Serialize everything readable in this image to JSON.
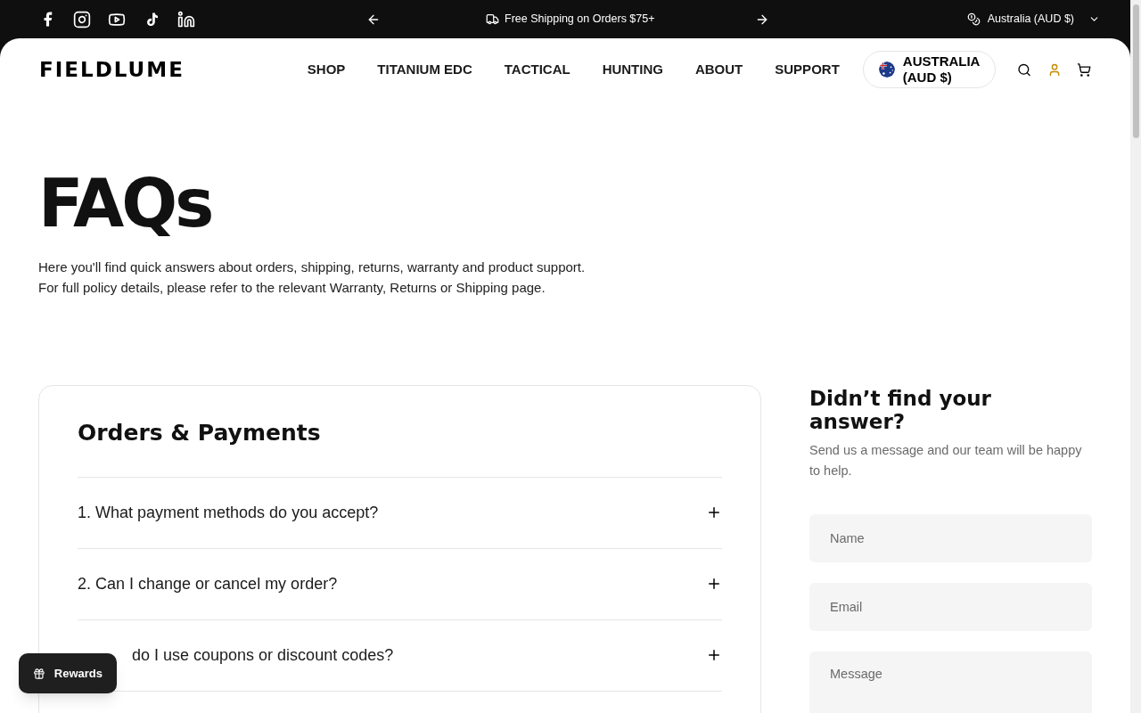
{
  "announcement_bar": {
    "message": "Free Shipping on Orders $75+",
    "currency": "Australia (AUD $)"
  },
  "header": {
    "logo": "FIELDLUME",
    "nav": [
      {
        "label": "SHOP"
      },
      {
        "label": "TITANIUM EDC"
      },
      {
        "label": "TACTICAL"
      },
      {
        "label": "HUNTING"
      },
      {
        "label": "ABOUT"
      },
      {
        "label": "SUPPORT"
      }
    ],
    "country_button": "AUSTRALIA (AUD $)"
  },
  "hero": {
    "title": "FAQs",
    "lines": [
      "Here you'll find quick answers about orders, shipping, returns, warranty and product support.",
      "For full policy details, please refer to the relevant Warranty, Returns or Shipping page."
    ]
  },
  "faq": {
    "section_title": "Orders & Payments",
    "items": [
      {
        "question": "1. What payment methods do you accept?",
        "expanded": false
      },
      {
        "question": "2. Can I change or cancel my order?",
        "expanded": false
      },
      {
        "question": "do I use coupons or discount codes?",
        "expanded": false,
        "kind": "partly_covered"
      }
    ]
  },
  "contact": {
    "title": "Didn’t find your answer?",
    "subtitle": "Send us a message and our team will be happy to help.",
    "fields": [
      {
        "placeholder": "Name"
      },
      {
        "placeholder": "Email"
      },
      {
        "placeholder": "Message"
      }
    ]
  },
  "rewards_button": "Rewards"
}
